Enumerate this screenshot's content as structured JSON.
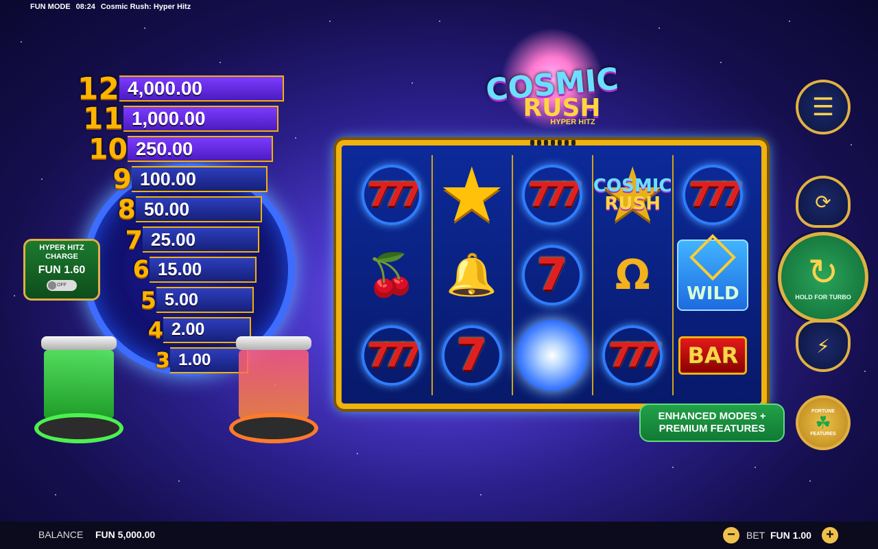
{
  "status": {
    "mode": "FUN MODE",
    "time": "08:24",
    "game_title": "Cosmic Rush: Hyper Hitz"
  },
  "logo": {
    "line1": "COSMIC",
    "line2": "RUSH",
    "line3": "HYPER HITZ"
  },
  "ladder": [
    {
      "level": "12",
      "prize": "4,000.00"
    },
    {
      "level": "11",
      "prize": "1,000.00"
    },
    {
      "level": "10",
      "prize": "250.00"
    },
    {
      "level": "9",
      "prize": "100.00"
    },
    {
      "level": "8",
      "prize": "50.00"
    },
    {
      "level": "7",
      "prize": "25.00"
    },
    {
      "level": "6",
      "prize": "15.00"
    },
    {
      "level": "5",
      "prize": "5.00"
    },
    {
      "level": "4",
      "prize": "2.00"
    },
    {
      "level": "3",
      "prize": "1.00"
    }
  ],
  "charge": {
    "title_line1": "HYPER HITZ",
    "title_line2": "CHARGE",
    "value": "FUN 1.60",
    "toggle_label": "OFF"
  },
  "reels": {
    "symbols": [
      [
        "triple-seven",
        "star",
        "triple-seven",
        "cosmic-rush-logo",
        "triple-seven"
      ],
      [
        "cherry",
        "bell",
        "seven",
        "horseshoe",
        "wild"
      ],
      [
        "triple-seven",
        "seven",
        "plasma-orb",
        "triple-seven",
        "bar"
      ]
    ],
    "wild_text": "WILD",
    "bar_text": "BAR",
    "logo_text_top": "COSMIC",
    "logo_text_bottom": "RUSH"
  },
  "buttons": {
    "menu_icon": "menu-icon",
    "autoplay_icon": "autoplay-icon",
    "spin_label": "HOLD FOR TURBO",
    "turbo_icon": "turbo-icon",
    "promo_line1": "ENHANCED MODES +",
    "promo_line2": "PREMIUM FEATURES",
    "fortune_top": "FORTUNE",
    "fortune_bottom": "FEATURES"
  },
  "footer": {
    "balance_label": "BALANCE",
    "balance_value": "FUN 5,000.00",
    "bet_label": "BET",
    "bet_value": "FUN 1.00"
  },
  "colors": {
    "gold": "#f0b20c",
    "ladder_purple": "#7c3bff",
    "ladder_blue": "#2d3ebd",
    "spin_green": "#2aa35a"
  }
}
